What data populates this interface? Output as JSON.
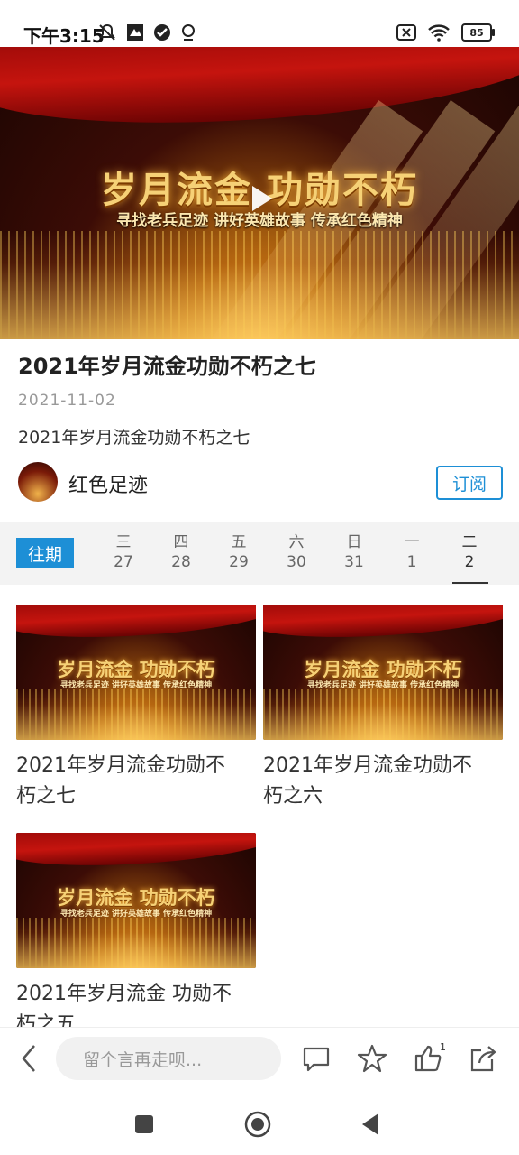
{
  "status_bar": {
    "time": "下午3:15",
    "battery": "85"
  },
  "hero": {
    "title": "岁月流金 功勋不朽",
    "subtitle": "寻找老兵足迹 讲好英雄故事 传承红色精神"
  },
  "article": {
    "title": "2021年岁月流金功勋不朽之七",
    "date": "2021-11-02",
    "description": "2021年岁月流金功勋不朽之七"
  },
  "channel": {
    "name": "红色足迹",
    "subscribe_label": "订阅"
  },
  "date_strip": {
    "past_label": "往期",
    "days": [
      {
        "weekday": "三",
        "date": "27"
      },
      {
        "weekday": "四",
        "date": "28"
      },
      {
        "weekday": "五",
        "date": "29"
      },
      {
        "weekday": "六",
        "date": "30"
      },
      {
        "weekday": "日",
        "date": "31"
      },
      {
        "weekday": "一",
        "date": "1"
      },
      {
        "weekday": "二",
        "date": "2"
      }
    ],
    "selected_index": 6
  },
  "cards": [
    {
      "label_line1": "2021年岁月流金功勋不",
      "label_line2": "朽之七",
      "thumb_title": "岁月流金 功勋不朽",
      "thumb_sub": "寻找老兵足迹 讲好英雄故事 传承红色精神"
    },
    {
      "label_line1": "2021年岁月流金功勋不",
      "label_line2": "朽之六",
      "thumb_title": "岁月流金 功勋不朽",
      "thumb_sub": "寻找老兵足迹 讲好英雄故事 传承红色精神"
    },
    {
      "label_line1": "2021年岁月流金  功勋不",
      "label_line2": "朽之五",
      "thumb_title": "岁月流金 功勋不朽",
      "thumb_sub": "寻找老兵足迹 讲好英雄故事 传承红色精神"
    }
  ],
  "bottom_bar": {
    "comment_placeholder": "留个言再走呗...",
    "like_count": "1",
    "icons": [
      "back-chevron-icon",
      "comment-icon",
      "star-icon",
      "thumbs-up-icon",
      "share-icon"
    ]
  },
  "colors": {
    "accent": "#1d8fd6",
    "strip_bg": "#f3f3f3"
  }
}
